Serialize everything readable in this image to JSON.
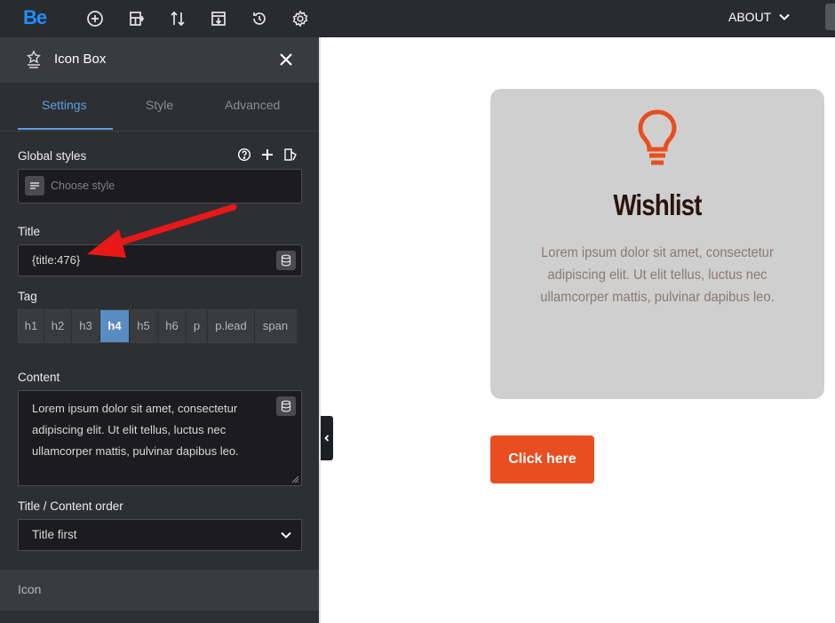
{
  "topbar": {
    "logo": "Be",
    "menu_label": "ABOUT"
  },
  "panel": {
    "title": "Icon Box",
    "tabs": [
      {
        "label": "Settings",
        "active": true
      },
      {
        "label": "Style",
        "active": false
      },
      {
        "label": "Advanced",
        "active": false
      }
    ],
    "global_styles": {
      "label": "Global styles",
      "placeholder": "Choose style"
    },
    "title_field": {
      "label": "Title",
      "value": "{title:476}"
    },
    "tag": {
      "label": "Tag",
      "options": [
        "h1",
        "h2",
        "h3",
        "h4",
        "h5",
        "h6",
        "p",
        "p.lead",
        "span"
      ],
      "selected": "h4"
    },
    "content": {
      "label": "Content",
      "value": "Lorem ipsum dolor sit amet, consectetur adipiscing elit. Ut elit tellus, luctus nec ullamcorper mattis, pulvinar dapibus leo."
    },
    "order": {
      "label": "Title / Content order",
      "value": "Title first"
    },
    "icon_section": {
      "label": "Icon"
    }
  },
  "canvas": {
    "card": {
      "title": "Wishlist",
      "text": "Lorem ipsum dolor sit amet, consectetur adipiscing elit. Ut elit tellus, luctus nec ullamcorper mattis, pulvinar dapibus leo."
    },
    "button_label": "Click here"
  },
  "colors": {
    "accent": "#5aa0e6",
    "brand": "#1f8fff",
    "cta": "#e84e1f",
    "annotation_arrow": "#e81818"
  }
}
